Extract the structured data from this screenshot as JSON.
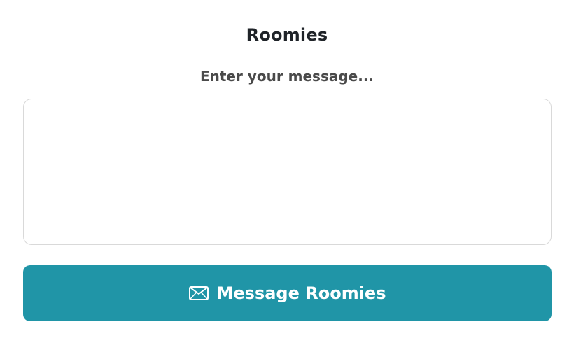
{
  "header": {
    "title": "Roomies"
  },
  "form": {
    "prompt_label": "Enter your message...",
    "message_value": "",
    "message_placeholder": ""
  },
  "actions": {
    "send_label": "Message Roomies",
    "send_icon": "envelope-icon"
  },
  "colors": {
    "button_bg": "#2095a7",
    "button_text": "#ffffff",
    "title_text": "#1f2328",
    "label_text": "#4a4a4a",
    "field_border": "#d9d9d9"
  }
}
